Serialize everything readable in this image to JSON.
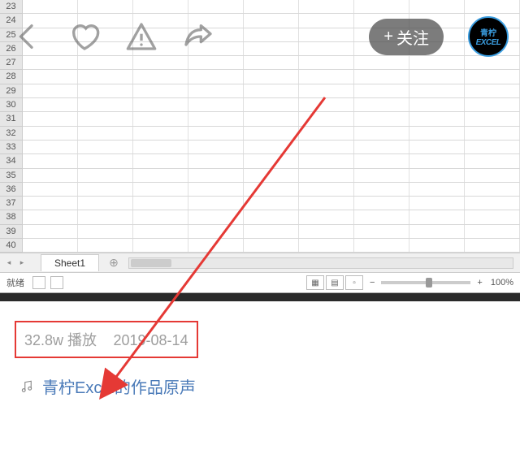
{
  "rows": [
    "23",
    "24",
    "25",
    "26",
    "27",
    "28",
    "29",
    "30",
    "31",
    "32",
    "33",
    "34",
    "35",
    "36",
    "37",
    "38",
    "39",
    "40"
  ],
  "sheet": {
    "tab": "Sheet1"
  },
  "statusbar": {
    "ready": "就绪",
    "zoom": "100%",
    "minus": "−",
    "plus": "+"
  },
  "overlay": {
    "follow": "关注",
    "plus": "+",
    "avatar1": "青柠",
    "avatar2": "EXCEL"
  },
  "meta": {
    "plays": "32.8w 播放",
    "date": "2019-08-14"
  },
  "audio": {
    "title": "青柠Excel的作品原声"
  }
}
